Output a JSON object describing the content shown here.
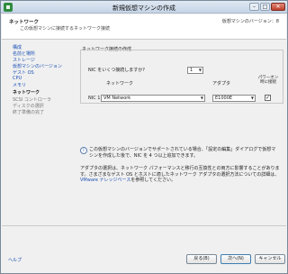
{
  "window": {
    "title": "新規仮想マシンの作成"
  },
  "header": {
    "title": "ネットワーク",
    "subtitle": "この仮想マシンに接続するネットワーク接続",
    "version": "仮想マシンのバージョン：8"
  },
  "nav": {
    "items": [
      {
        "label": "構成",
        "state": "done"
      },
      {
        "label": "名前と場所",
        "state": "done"
      },
      {
        "label": "ストレージ",
        "state": "done"
      },
      {
        "label": "仮想マシンのバージョン",
        "state": "done"
      },
      {
        "label": "ゲスト OS",
        "state": "done"
      },
      {
        "label": "CPU",
        "state": "done"
      },
      {
        "label": "メモリ",
        "state": "done"
      },
      {
        "label": "ネットワーク",
        "state": "current"
      },
      {
        "label": "SCSI コントローラ",
        "state": "pending"
      },
      {
        "label": "ディスクの選択",
        "state": "pending"
      },
      {
        "label": "終了準備の完了",
        "state": "pending"
      }
    ]
  },
  "network": {
    "group_title": "ネットワーク接続の作成",
    "count_label": "NIC をいくつ接続しますか?",
    "count_value": "1",
    "col_network": "ネットワーク",
    "col_adapter": "アダプタ",
    "col_connect": "パワーオン時に接続",
    "nic_label": "NIC 1:",
    "nic_network": "VM Network",
    "nic_adapter": "E1000E",
    "nic_connect": true
  },
  "info": {
    "text1": "この仮想マシンのバージョンでサポートされている場合、「設定の編集」ダイアログで仮想マシンを作成した後で、NIC を 4 つ以上追加できます。",
    "text2": "アダプタの選択は、ネットワーク パフォーマンスと移行の互換性との両方に影響することがあります。さまざまなゲスト OS とホストに適したネットワーク アダプタの選択方法についての詳細は、",
    "link": "VMware ナレッジベース",
    "text3": "を参照してください。"
  },
  "footer": {
    "help": "ヘルプ",
    "back": "戻る(B)",
    "next": "次へ(N)",
    "cancel": "キャンセル"
  },
  "colors": {
    "title_bar": "#c5d4e6",
    "link": "#1a4fb5",
    "close": "#c0402a"
  }
}
